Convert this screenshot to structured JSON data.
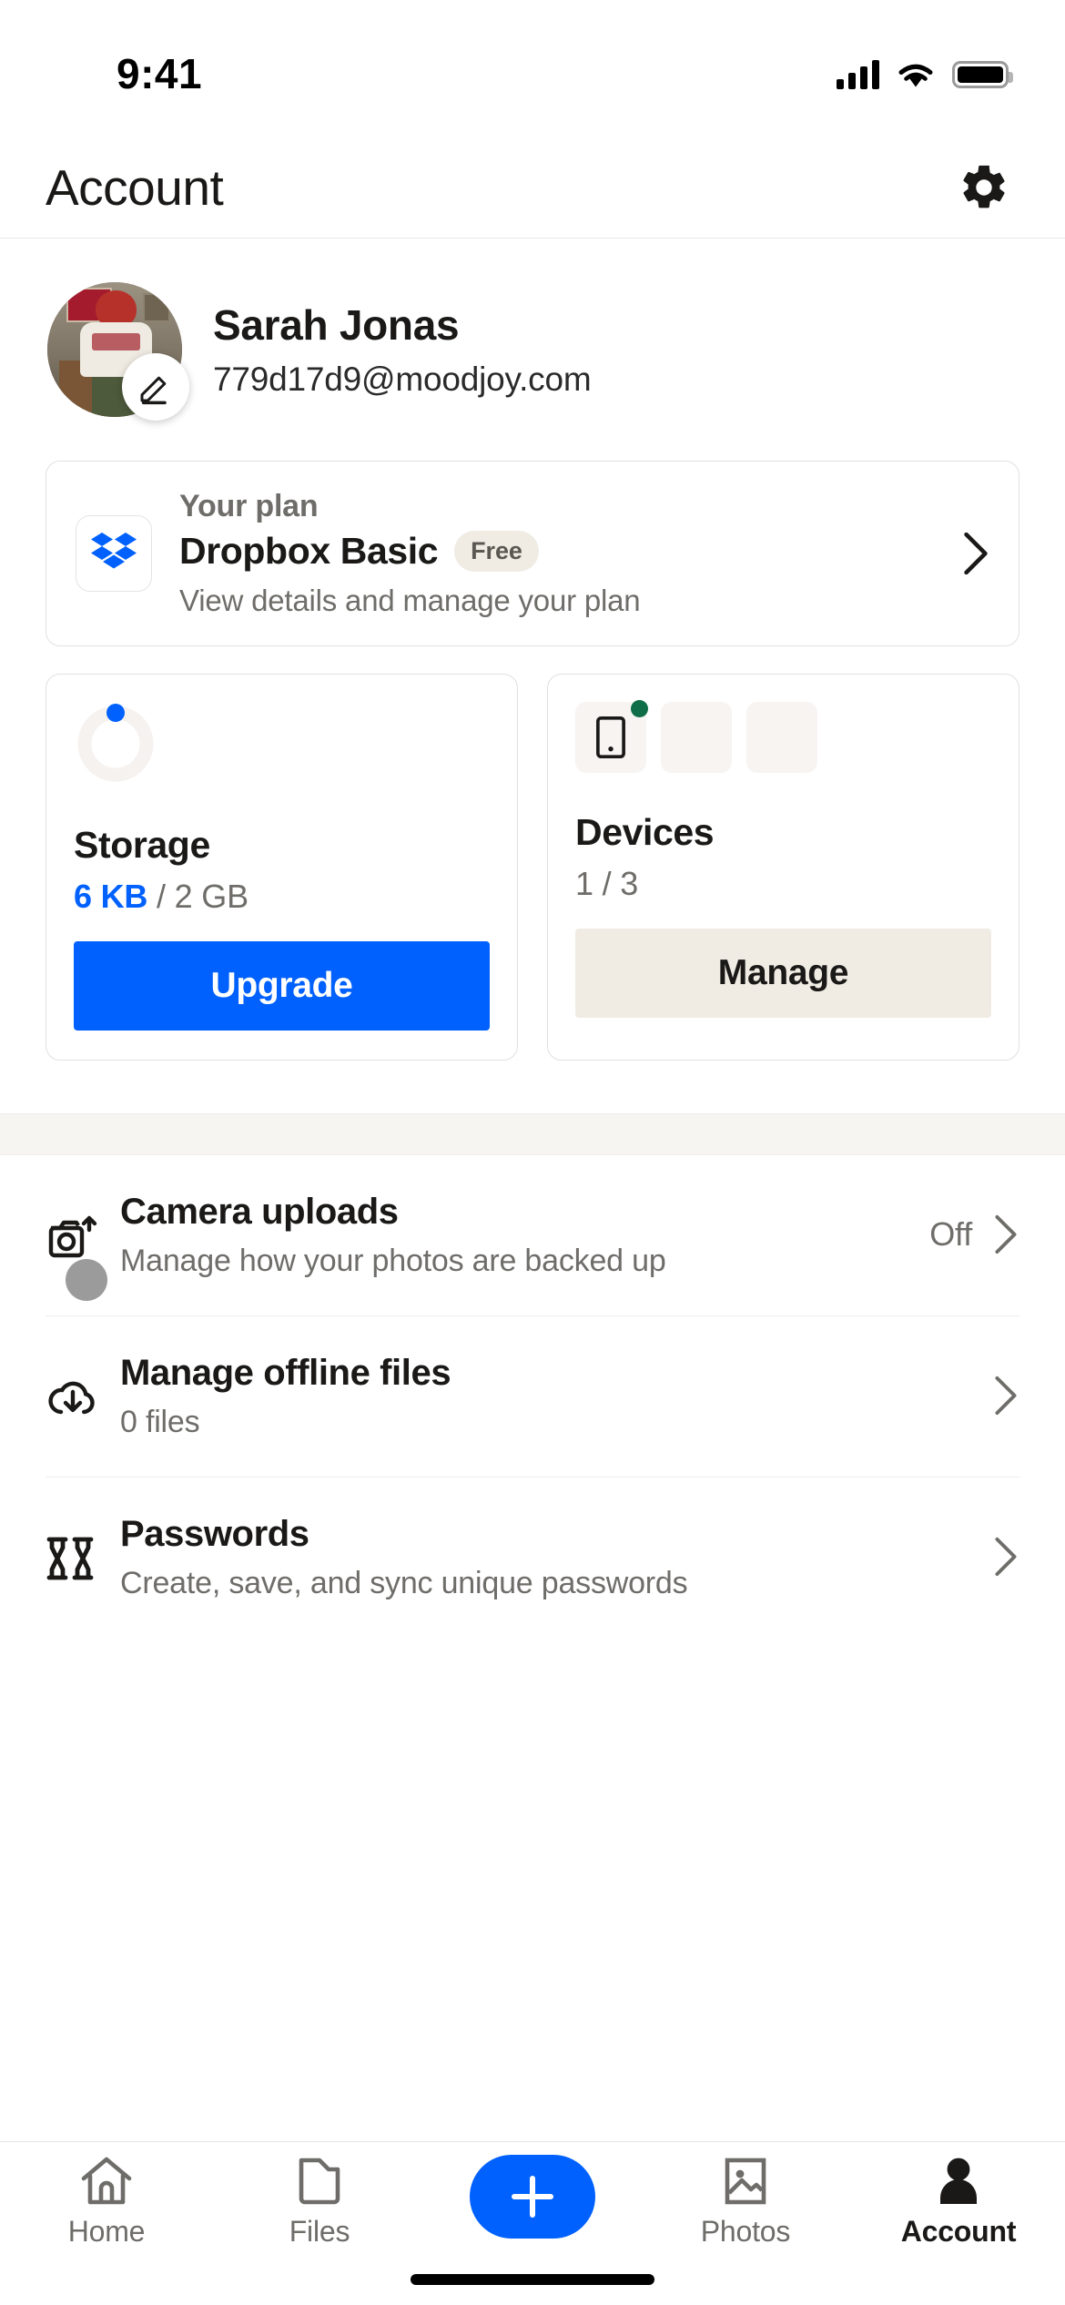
{
  "status_bar": {
    "time": "9:41",
    "cellular_icon": "signal-bars-icon",
    "wifi_icon": "wifi-icon",
    "battery_icon": "battery-icon"
  },
  "header": {
    "title": "Account",
    "settings_icon": "gear-icon"
  },
  "profile": {
    "name": "Sarah Jonas",
    "email": "779d17d9@moodjoy.com",
    "avatar_name": "avatar",
    "edit_icon": "pencil-icon"
  },
  "plan_card": {
    "logo_icon": "dropbox-logo-icon",
    "kicker": "Your plan",
    "title": "Dropbox Basic",
    "badge": "Free",
    "subtitle": "View details and manage your plan",
    "chevron_icon": "chevron-right-icon"
  },
  "storage_card": {
    "title": "Storage",
    "used": "6 KB",
    "separator": " / ",
    "total": "2 GB",
    "button_label": "Upgrade",
    "ring_icon": "storage-ring-icon",
    "percent_used": 1
  },
  "devices_card": {
    "title": "Devices",
    "count": "1 / 3",
    "button_label": "Manage",
    "device_icon": "mobile-device-icon",
    "status_dot": "online-dot-icon"
  },
  "settings_rows": [
    {
      "icon": "camera-upload-icon",
      "title": "Camera uploads",
      "subtitle": "Manage how your photos are backed up",
      "value": "Off",
      "chevron_icon": "chevron-right-icon",
      "has_badge": true
    },
    {
      "icon": "cloud-download-icon",
      "title": "Manage offline files",
      "subtitle": "0 files",
      "value": "",
      "chevron_icon": "chevron-right-icon",
      "has_badge": false
    },
    {
      "icon": "passwords-icon",
      "title": "Passwords",
      "subtitle": "Create, save, and sync unique passwords",
      "value": "",
      "chevron_icon": "chevron-right-icon",
      "has_badge": false
    }
  ],
  "tab_bar": {
    "tabs": [
      {
        "label": "Home",
        "icon": "home-icon",
        "active": false
      },
      {
        "label": "Files",
        "icon": "folder-icon",
        "active": false
      },
      {
        "label": "",
        "icon": "plus-icon",
        "active": false
      },
      {
        "label": "Photos",
        "icon": "photos-icon",
        "active": false
      },
      {
        "label": "Account",
        "icon": "person-icon",
        "active": true
      }
    ]
  },
  "colors": {
    "accent": "#0061fe",
    "badge_bg": "#f0ece4",
    "online": "#0f6e47",
    "text": "#1a1918",
    "muted": "#6f6d6a"
  }
}
